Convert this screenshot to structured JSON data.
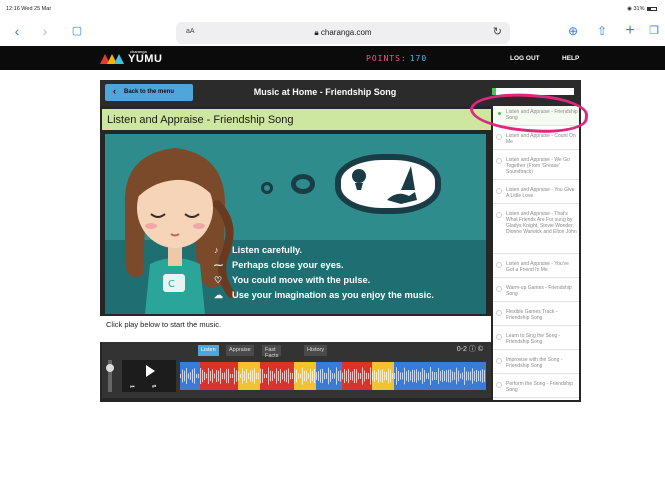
{
  "status": {
    "time": "12:16  Wed 25 Mar",
    "battery": "31%"
  },
  "browser": {
    "reader": "aA",
    "url": "charanga.com"
  },
  "site": {
    "brand": "charanga",
    "name": "YUMU",
    "points_label": "POINTS:",
    "points_value": "170",
    "logout": "LOG OUT",
    "help": "HELP"
  },
  "app": {
    "back_label": "Back to the menu",
    "title": "Music at Home - Friendship Song",
    "progress_fraction": 0.05,
    "subtitle": "Listen and Appraise - Friendship Song",
    "instructions": [
      "Listen carefully.",
      "Perhaps close your eyes.",
      "You could move with the pulse.",
      "Use your imagination as you enjoy the music."
    ],
    "caption": "Click play below to start the music.",
    "tabs": [
      "Listen",
      "Appraise",
      "Fast Facts",
      "History"
    ],
    "active_tab": "Listen",
    "tool_label": "0-2"
  },
  "sidebar": {
    "items": [
      {
        "label": "Listen and Appraise - Friendship Song",
        "selected": true
      },
      {
        "label": "Listen and Appraise - Count On Me",
        "selected": false
      },
      {
        "label": "Listen and Appraise - We Go Together (From 'Grease' Soundtrack)",
        "selected": false
      },
      {
        "label": "Listen and Appraise - You Give A Little Love",
        "selected": false
      },
      {
        "label": "Listen and Appraise - That's What Friends Are For sung by Gladys Knight, Stevie Wonder, Dionne Warwick and Elton John",
        "selected": false
      },
      {
        "label": "Listen and Appraise - You've Got a Friend In Me",
        "selected": false
      },
      {
        "label": "Warm-up Games - Friendship Song",
        "selected": false
      },
      {
        "label": "Flexible Games Track - Friendship Song",
        "selected": false
      },
      {
        "label": "Learn to Sing the Song - Friendship Song",
        "selected": false
      },
      {
        "label": "Improvise with the Song - Friendship Song",
        "selected": false
      },
      {
        "label": "Perform the Song - Friendship Song",
        "selected": false
      }
    ]
  },
  "colors": {
    "accent": "#4ba6dc",
    "annotation": "#e0277e",
    "progress": "#4bc35a"
  }
}
